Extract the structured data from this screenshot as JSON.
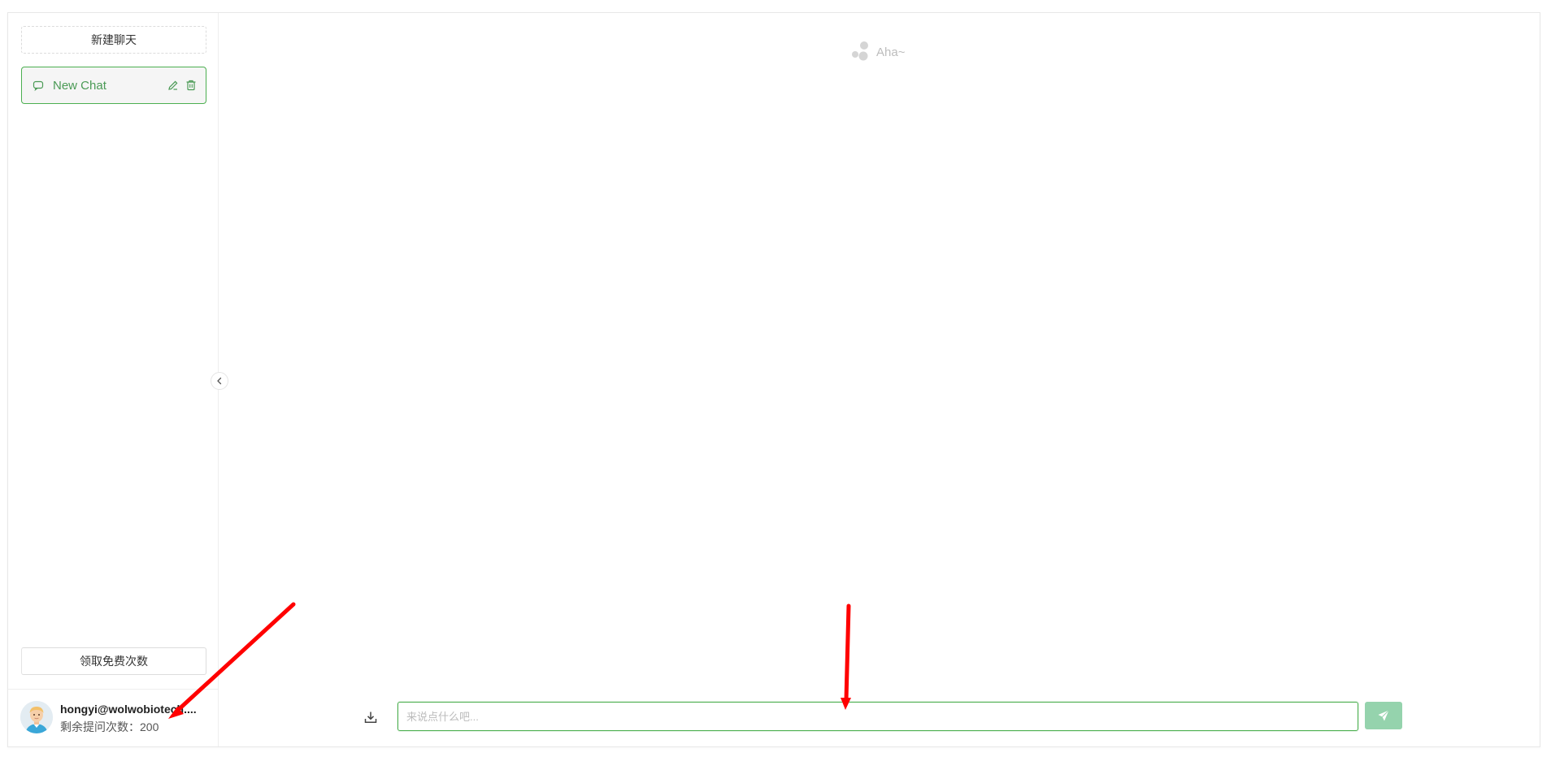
{
  "sidebar": {
    "new_chat_label": "新建聊天",
    "chats": [
      {
        "label": "New Chat",
        "active": true
      }
    ],
    "free_quota_label": "领取免费次数",
    "user": {
      "name": "hongyi@wolwobiotech....",
      "quota_text": "剩余提问次数：200"
    }
  },
  "main": {
    "empty_text": "Aha~",
    "input": {
      "placeholder": "来说点什么吧...",
      "value": ""
    }
  },
  "colors": {
    "accent": "#4caf50",
    "send_bg": "#95d3ad",
    "annotation": "#ff0000"
  },
  "icons": {
    "chat_item": "chat-bubble-icon",
    "edit": "edit-icon",
    "delete": "trash-icon",
    "collapse": "chevron-left-icon",
    "download": "download-icon",
    "send": "send-icon",
    "logo": "dots-logo-icon"
  }
}
